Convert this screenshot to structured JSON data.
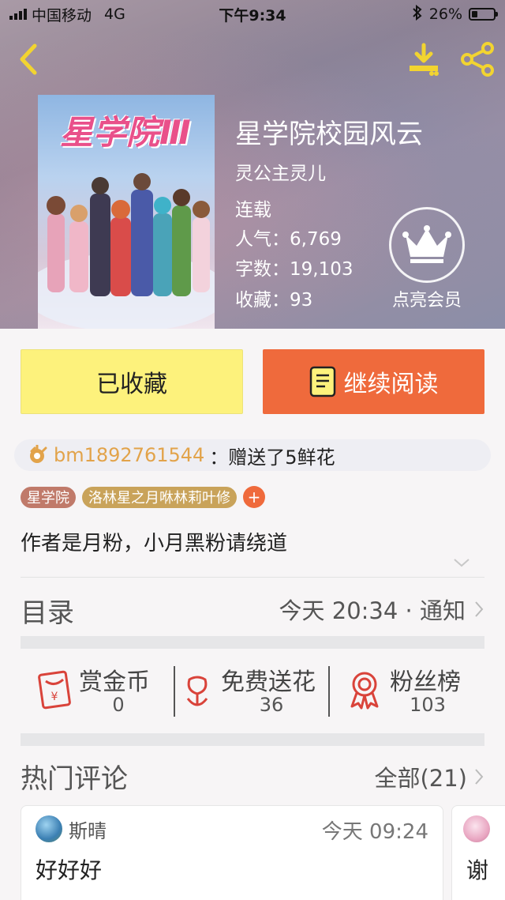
{
  "status_bar": {
    "carrier": "中国移动",
    "network": "4G",
    "time": "下午9:34",
    "battery": "26%",
    "battery_level": 0.26
  },
  "book": {
    "title": "星学院校园风云",
    "author": "灵公主灵儿",
    "status": "连载",
    "popularity": "人气：6,769",
    "words": "字数：19,103",
    "favorites": "收藏：93",
    "cover_logo_text": "星学院Ⅲ"
  },
  "vip_label": "点亮会员",
  "buttons": {
    "favorited": "已收藏",
    "continue": "继续阅读"
  },
  "gift": {
    "user": "bm1892761544",
    "message": "：赠送了5鲜花"
  },
  "tags": [
    "星学院",
    "洛林星之月咻林莉叶修"
  ],
  "tag_add": "+",
  "intro": "作者是月粉，小月黑粉请绕道",
  "toc": {
    "label": "目录",
    "info": "今天 20:34 · 通知"
  },
  "stats": [
    {
      "name": "赏金币",
      "value": "0",
      "icon": "red-envelope-icon"
    },
    {
      "name": "免费送花",
      "value": "36",
      "icon": "flower-icon"
    },
    {
      "name": "粉丝榜",
      "value": "103",
      "icon": "medal-icon"
    }
  ],
  "hot_comments": {
    "title": "热门评论",
    "all": "全部(21)"
  },
  "comments": [
    {
      "user": "斯晴",
      "time": "今天 09:24",
      "text": "好好好"
    },
    {
      "text": "谢"
    }
  ],
  "colors": {
    "accent_orange": "#ef6a3c",
    "favorite_yellow": "#fdf27c",
    "gift_user": "#e2a34a"
  }
}
